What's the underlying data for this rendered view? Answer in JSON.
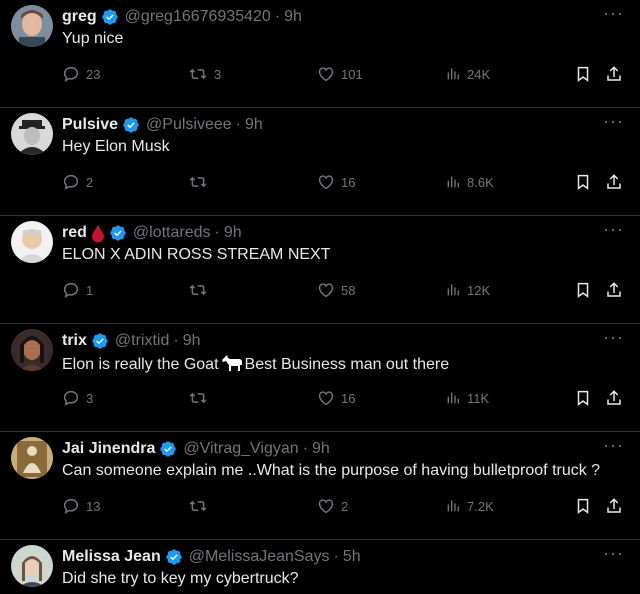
{
  "tweets": [
    {
      "name": "greg",
      "emoji": "",
      "handle": "@greg16676935420",
      "time": "9h",
      "text": "Yup nice",
      "text_after": "",
      "replies": "23",
      "retweets": "3",
      "likes": "101",
      "views": "24K"
    },
    {
      "name": "Pulsive",
      "emoji": "",
      "handle": "@Pulsiveee",
      "time": "9h",
      "text": "Hey Elon Musk",
      "text_after": "",
      "replies": "2",
      "retweets": "",
      "likes": "16",
      "views": "8.6K"
    },
    {
      "name": "red",
      "emoji": "blood-drop",
      "handle": "@lottareds",
      "time": "9h",
      "text": "ELON X ADIN ROSS STREAM NEXT",
      "text_after": "",
      "replies": "1",
      "retweets": "",
      "likes": "58",
      "views": "12K"
    },
    {
      "name": "trix",
      "emoji": "",
      "handle": "@trixtid",
      "time": "9h",
      "text": "Elon is really the Goat",
      "text_after": "Best Business man out there",
      "replies": "3",
      "retweets": "",
      "likes": "16",
      "views": "11K"
    },
    {
      "name": "Jai Jinendra",
      "emoji": "",
      "handle": "@Vitrag_Vigyan",
      "time": "9h",
      "text": "Can someone explain me ..What is the purpose of having bulletproof truck ?",
      "text_after": "",
      "replies": "13",
      "retweets": "",
      "likes": "2",
      "views": "7.2K"
    },
    {
      "name": "Melissa Jean",
      "emoji": "",
      "handle": "@MelissaJeanSays",
      "time": "5h",
      "text": "Did she try to key my cybertruck?",
      "text_after": "",
      "replies": "",
      "retweets": "",
      "likes": "",
      "views": ""
    }
  ],
  "separator": "·",
  "more_label": "···",
  "colors": {
    "background": "#000000",
    "text": "#e7e9ea",
    "muted": "#71767b",
    "verified": "#1d9bf0",
    "border": "#2f3336"
  },
  "icons": [
    "verified-badge-icon",
    "reply-icon",
    "retweet-icon",
    "like-icon",
    "views-icon",
    "bookmark-icon",
    "share-icon",
    "more-icon"
  ]
}
